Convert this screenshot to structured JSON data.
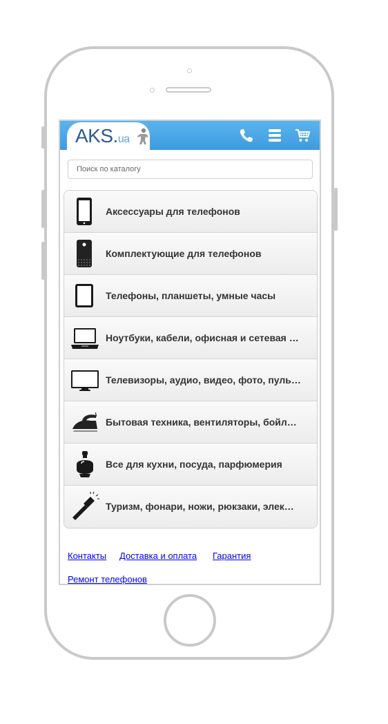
{
  "header": {
    "logo_main": "AKS.",
    "logo_suffix": "ua",
    "brand_color": "#3d9be0",
    "icons": [
      "phone-icon",
      "menu-icon",
      "cart-icon"
    ]
  },
  "search": {
    "placeholder": "Поиск по каталогу"
  },
  "menu": {
    "items": [
      {
        "label": "Аксессуары для телефонов",
        "icon": "smartphone-icon"
      },
      {
        "label": "Комплектующие для телефонов",
        "icon": "phone-back-icon"
      },
      {
        "label": "Телефоны, планшеты, умные часы",
        "icon": "tablet-icon"
      },
      {
        "label": "Ноутбуки, кабели, офисная и сетевая …",
        "icon": "laptop-icon"
      },
      {
        "label": "Телевизоры, аудио, видео, фото, пуль…",
        "icon": "tv-icon"
      },
      {
        "label": "Бытовая техника, вентиляторы, бойл…",
        "icon": "iron-icon"
      },
      {
        "label": "Все для кухни, посуда, парфюмерия",
        "icon": "perfume-icon"
      },
      {
        "label": "Туризм, фонари, ножи, рюкзаки, элек…",
        "icon": "flashlight-icon"
      }
    ]
  },
  "footer": {
    "links": [
      "Контакты",
      "Доставка и оплата",
      "Гарантия",
      "Ремонт телефонов"
    ]
  }
}
